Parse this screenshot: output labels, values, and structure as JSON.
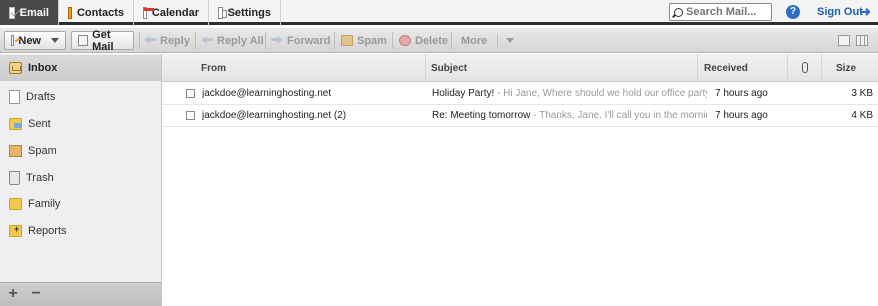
{
  "nav": {
    "tabs": [
      {
        "label": "Email",
        "icon": "email-icon",
        "active": true
      },
      {
        "label": "Contacts",
        "icon": "contacts-icon"
      },
      {
        "label": "Calendar",
        "icon": "calendar-icon"
      },
      {
        "label": "Settings",
        "icon": "settings-icon"
      }
    ],
    "search_placeholder": "Search Mail...",
    "help_label": "?",
    "signout_label": "Sign Out"
  },
  "toolbar": {
    "new_label": "New",
    "getmail_label": "Get Mail",
    "reply_label": "Reply",
    "replyall_label": "Reply All",
    "forward_label": "Forward",
    "spam_label": "Spam",
    "delete_label": "Delete",
    "more_label": "More"
  },
  "sidebar": {
    "folders": [
      {
        "label": "Inbox",
        "icon": "inbox-icon",
        "active": true
      },
      {
        "label": "Drafts",
        "icon": "drafts-icon"
      },
      {
        "label": "Sent",
        "icon": "sent-folder-icon"
      },
      {
        "label": "Spam",
        "icon": "spam-folder-icon"
      },
      {
        "label": "Trash",
        "icon": "trash-icon"
      },
      {
        "label": "Family",
        "icon": "folder-icon"
      },
      {
        "label": "Reports",
        "icon": "folder-add-icon"
      }
    ],
    "add_label": "+",
    "remove_label": "−"
  },
  "list": {
    "columns": {
      "from": "From",
      "subject": "Subject",
      "received": "Received",
      "size": "Size"
    },
    "rows": [
      {
        "from": "jackdoe@learninghosting.net",
        "subject": "Holiday Party!",
        "preview": " - Hi Jane, Where should we hold our office party this y",
        "received": "7 hours ago",
        "size": "3 KB"
      },
      {
        "from": "jackdoe@learninghosting.net (2)",
        "subject": "Re: Meeting tomorrow",
        "preview": " - Thanks, Jane.  I'll call you in the morning. J",
        "received": "7 hours ago",
        "size": "4 KB"
      }
    ]
  },
  "colors": {
    "accent": "#1a5fb4",
    "active_tab": "#4a4a4a"
  }
}
